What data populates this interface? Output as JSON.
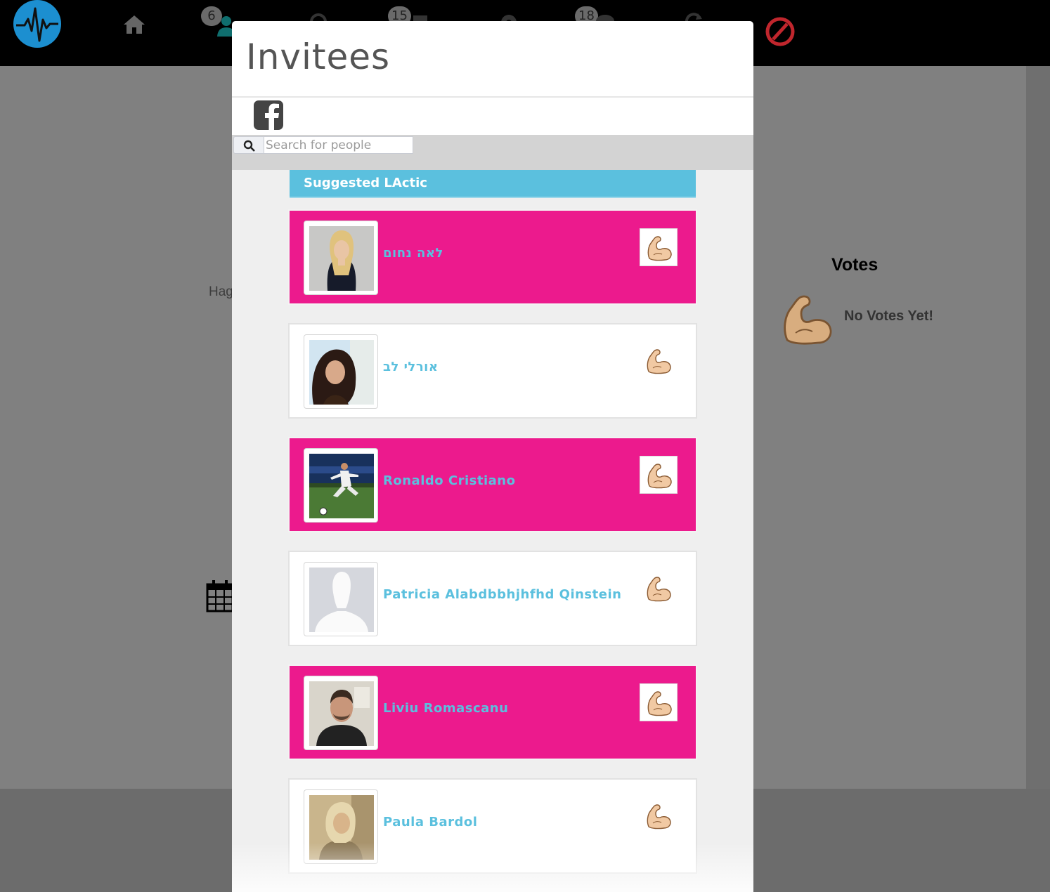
{
  "app": {
    "logo": "pulse-logo-icon"
  },
  "nav": {
    "items": [
      {
        "icon": "home-icon",
        "badge": ""
      },
      {
        "icon": "friends-icon",
        "badge": "6"
      },
      {
        "icon": "search-icon",
        "badge": ""
      },
      {
        "icon": "thumbs-up-icon",
        "badge": "15"
      },
      {
        "icon": "settings-icon",
        "badge": ""
      },
      {
        "icon": "messages-icon",
        "badge": "18"
      },
      {
        "icon": "refresh-icon",
        "badge": ""
      },
      {
        "icon": "no-icon",
        "badge": ""
      }
    ],
    "friends_badge": "6",
    "activity_badge": "15",
    "messages_badge": "18"
  },
  "background": {
    "truncated_text": "Hag",
    "votes_title": "Votes",
    "votes_empty": "No Votes Yet!"
  },
  "modal": {
    "title": "Invitees",
    "social_icon": "facebook-icon",
    "search_placeholder": "Search for people",
    "search_value": "",
    "section_header": "Suggested LActic",
    "people": [
      {
        "name": "לאה נחום",
        "style": "highlighted"
      },
      {
        "name": "אורלי לב",
        "style": "plain"
      },
      {
        "name": "Ronaldo Cristiano",
        "style": "highlighted"
      },
      {
        "name": "Patricia Alabdbbhjhfhd Qinstein",
        "style": "plain"
      },
      {
        "name": "Liviu Romascanu",
        "style": "highlighted"
      },
      {
        "name": "Paula Bardol",
        "style": "plain"
      }
    ],
    "vote_icon": "flexed-biceps-icon"
  },
  "colors": {
    "topbar": "#000000",
    "accent_blue": "#5bc0de",
    "highlight_pink": "#ec1a8d",
    "logo_blue": "#1c8fd0",
    "no_icon_red": "#c0262d"
  }
}
